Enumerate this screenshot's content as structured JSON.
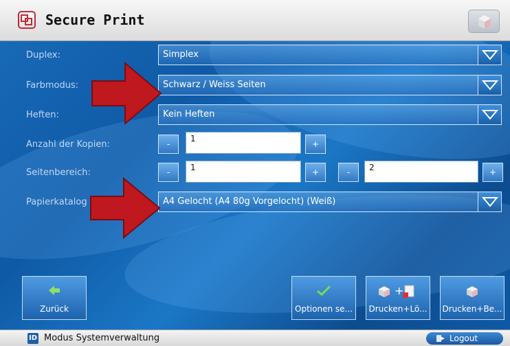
{
  "app": {
    "title": "Secure Print"
  },
  "form": {
    "duplex": {
      "label": "Duplex:",
      "value": "Simplex"
    },
    "farbmodus": {
      "label": "Farbmodus:",
      "value": "Schwarz / Weiss Seiten"
    },
    "heften": {
      "label": "Heften:",
      "value": "Kein Heften"
    },
    "kopien": {
      "label": "Anzahl der Kopien:",
      "value": "1"
    },
    "seitenbereich": {
      "label": "Seitenbereich:",
      "from": "1",
      "to": "2"
    },
    "papierkatalog": {
      "label": "Papierkatalog",
      "value": "A4 Gelocht (A4 80g Vorgelocht) (Weiß)"
    }
  },
  "stepper": {
    "minus": "-",
    "plus": "+"
  },
  "buttons": {
    "back": "Zurück",
    "options": "Optionen se...",
    "print_delete": "Drucken+Lö...",
    "print_keep": "Drucken+Be..."
  },
  "status": {
    "badge": "ID",
    "mode": "Modus Systemverwaltung",
    "logout": "Logout"
  },
  "colors": {
    "accent": "#1a62b0",
    "arrow": "#c0181f",
    "check": "#7ed957"
  },
  "icons": [
    "app-logo-icon",
    "cube-icon",
    "dropdown-arrow-icon",
    "back-arrow-icon",
    "checkmark-icon",
    "print-delete-icon",
    "print-icon",
    "logout-icon"
  ]
}
